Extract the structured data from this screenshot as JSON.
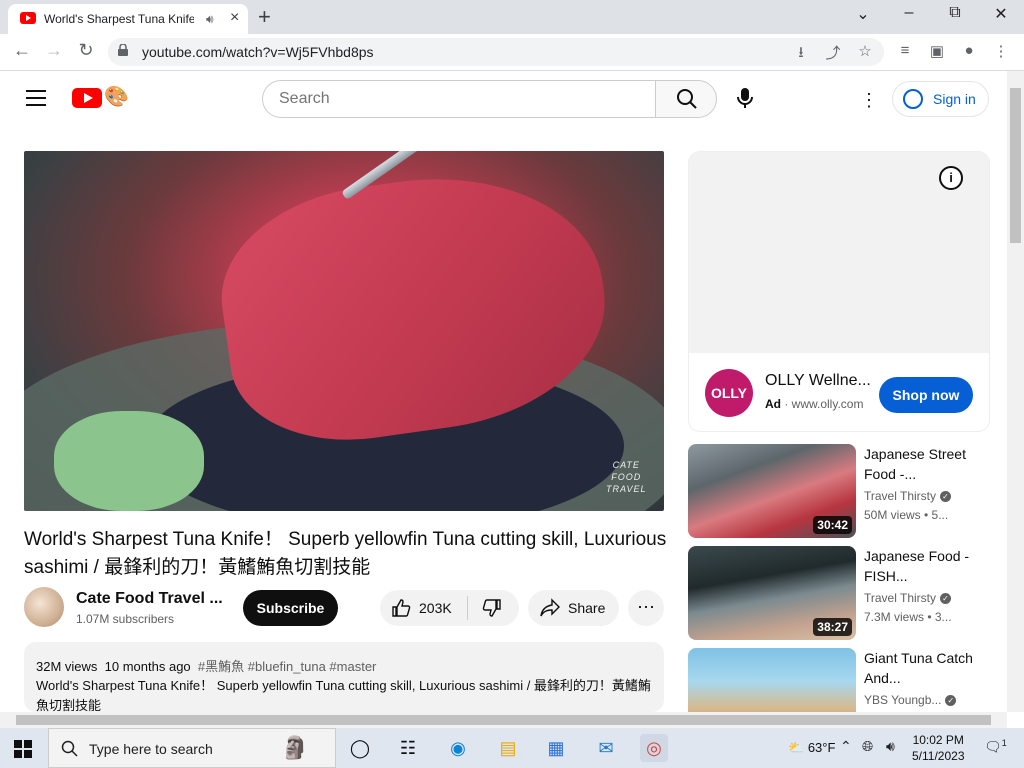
{
  "browser": {
    "tab_title": "World's Sharpest Tuna Knife",
    "url": "youtube.com/watch?v=Wj5FVhbd8ps",
    "new_tab": "+",
    "tab_close": "×"
  },
  "masthead": {
    "search_placeholder": "Search",
    "sign_in": "Sign in"
  },
  "video": {
    "watermark_line1": "CATE",
    "watermark_line2": "FOOD",
    "watermark_line3": "TRAVEL",
    "title": "World's Sharpest Tuna Knife！ Superb yellowfin Tuna cutting skill, Luxurious sashimi / 最鋒利的刀！黃鰭鮪魚切割技能",
    "channel": "Cate Food Travel ...",
    "subscribers": "1.07M subscribers",
    "subscribe": "Subscribe",
    "likes": "203K",
    "share": "Share",
    "views": "32M views",
    "age": "10 months ago",
    "tags": "#黑鮪魚 #bluefin_tuna #master",
    "description": "World's Sharpest Tuna Knife！ Superb yellowfin Tuna cutting skill, Luxurious sashimi / 最鋒利的刀！黃鰭鮪魚切割技能"
  },
  "ad": {
    "logo_text": "OLLY",
    "name": "OLLY Wellne...",
    "ad_label": "Ad",
    "domain": "www.olly.com",
    "cta": "Shop now",
    "info": "i"
  },
  "recommendations": [
    {
      "title": "Japanese Street Food -...",
      "channel": "Travel Thirsty",
      "meta": "50M views • 5...",
      "duration": "30:42"
    },
    {
      "title": "Japanese Food - FISH...",
      "channel": "Travel Thirsty",
      "meta": "7.3M views • 3...",
      "duration": "38:27"
    },
    {
      "title": "Giant Tuna Catch And...",
      "channel": "YBS Youngb...",
      "meta": "",
      "duration": ""
    }
  ],
  "taskbar": {
    "search_placeholder": "Type here to search",
    "temperature": "63°F",
    "time": "10:02 PM",
    "date": "5/11/2023",
    "notification_count": "1"
  },
  "colors": {
    "youtube_red": "#ff0000",
    "link_blue": "#065fd4",
    "olly_magenta": "#c01a6b"
  }
}
